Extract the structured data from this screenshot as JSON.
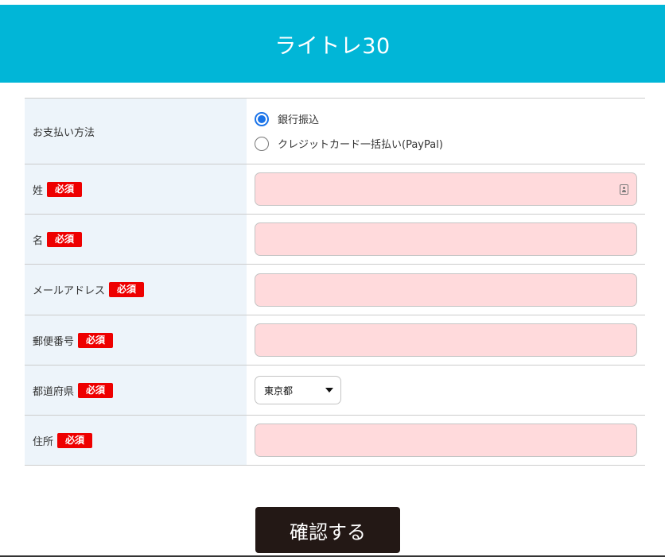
{
  "header": {
    "title": "ライトレ30"
  },
  "form": {
    "payment": {
      "label": "お支払い方法",
      "options": [
        {
          "label": "銀行振込",
          "checked": true
        },
        {
          "label": "クレジットカード一括払い(PayPal)",
          "checked": false
        }
      ]
    },
    "required_badge": "必須",
    "last_name": {
      "label": "姓",
      "value": ""
    },
    "first_name": {
      "label": "名",
      "value": ""
    },
    "email": {
      "label": "メールアドレス",
      "value": ""
    },
    "postal_code": {
      "label": "郵便番号",
      "value": ""
    },
    "prefecture": {
      "label": "都道府県",
      "selected": "東京都"
    },
    "address": {
      "label": "住所",
      "value": ""
    }
  },
  "submit": {
    "label": "確認する"
  },
  "colors": {
    "header_bg": "#01b6d7",
    "label_bg": "#edf4fa",
    "input_bg": "#ffdadc",
    "badge_bg": "#ee0000",
    "button_bg": "#231815",
    "radio_accent": "#1a73e8"
  }
}
